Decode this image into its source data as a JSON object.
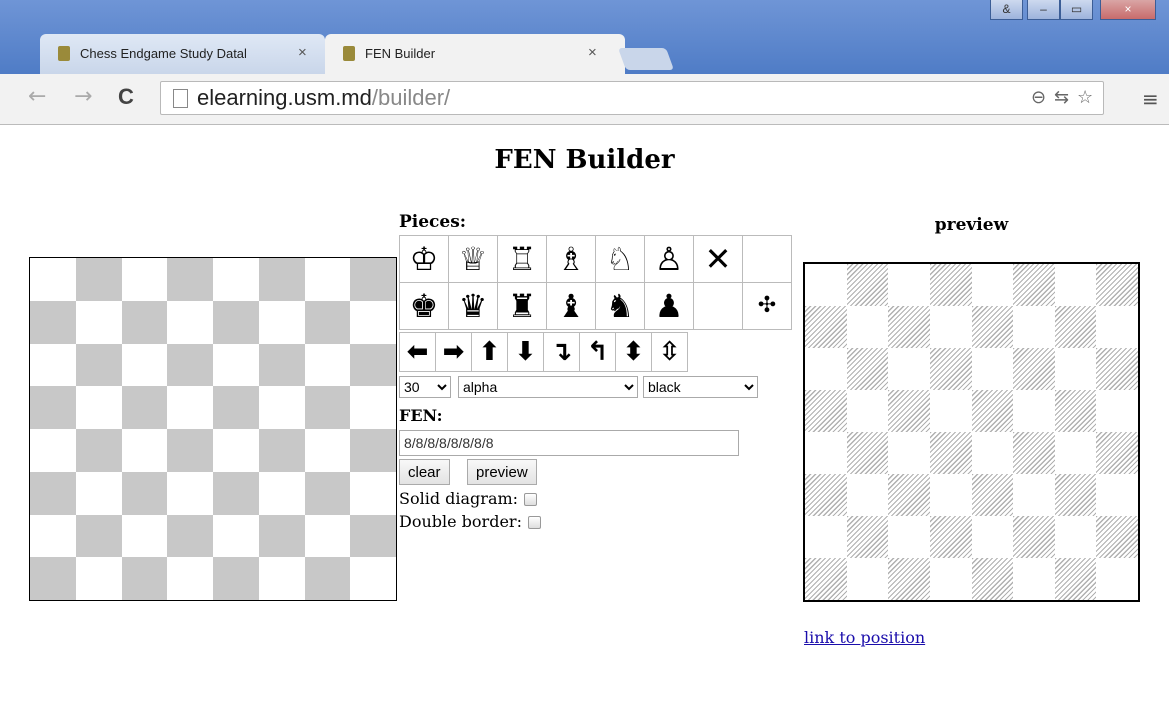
{
  "browser": {
    "tabs": [
      {
        "title": "Chess Endgame Study Datal",
        "close": "×",
        "active": false
      },
      {
        "title": "FEN Builder",
        "close": "×",
        "active": true
      }
    ],
    "window_buttons": [
      "&",
      "–",
      "▭",
      "×"
    ],
    "address": {
      "host": "elearning.usm.md",
      "path": "/builder/"
    },
    "nav": {
      "back": "←",
      "forward": "→",
      "reload": "C"
    },
    "icons": {
      "zoom": "⊖",
      "translate": "⇆",
      "bookmark": "☆",
      "menu": "≡"
    }
  },
  "page": {
    "title": "FEN Builder",
    "pieces_label": "Pieces:",
    "preview_label": "preview",
    "white_pieces": [
      "♔",
      "♕",
      "♖",
      "♗",
      "♘",
      "♙",
      "✕",
      ""
    ],
    "black_pieces": [
      "♚",
      "♛",
      "♜",
      "♝",
      "♞",
      "♟",
      "",
      "✣"
    ],
    "arrows": [
      "⬅",
      "➡",
      "⬆",
      "⬇",
      "↴",
      "↰",
      "⬍",
      "⇳"
    ],
    "size_select": "30",
    "style_select": "alpha",
    "color_select": "black",
    "fen_label": "FEN:",
    "fen_value": "8/8/8/8/8/8/8/8",
    "clear_button": "clear",
    "preview_button": "preview",
    "solid_label": "Solid diagram:",
    "double_label": "Double border:",
    "link_text": "link to position"
  }
}
